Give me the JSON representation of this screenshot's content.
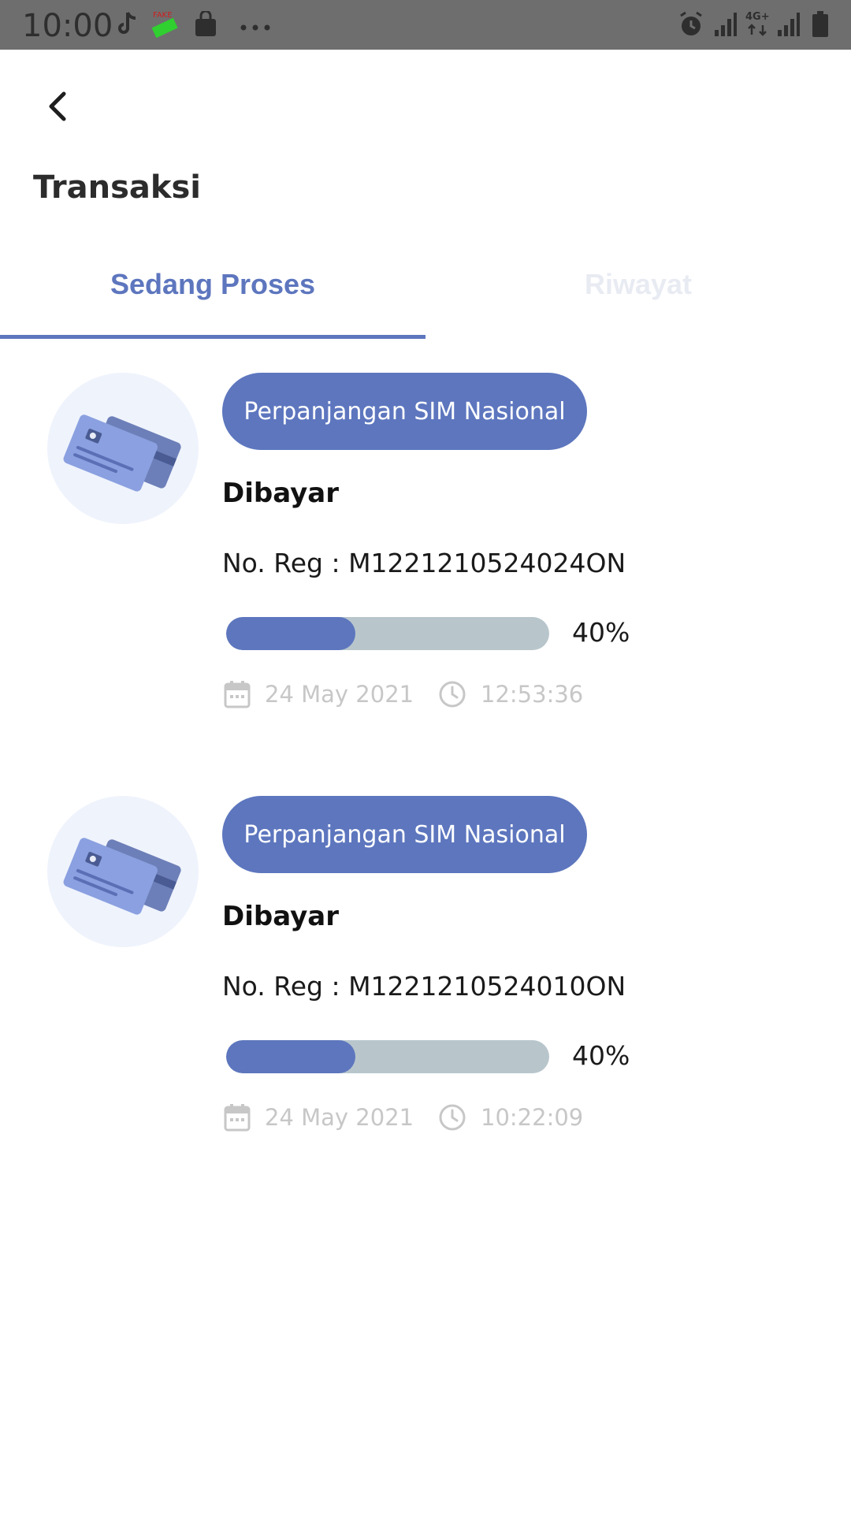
{
  "status_bar": {
    "time": "10:00",
    "left_icons": [
      "tiktok-icon",
      "fake-gps-icon",
      "shopping-bag-icon",
      "more-dots-icon"
    ],
    "right_icons": [
      "alarm-icon",
      "signal-icon",
      "network-4g-icon",
      "signal-icon",
      "battery-icon"
    ],
    "network_label": "4G+"
  },
  "header": {
    "title": "Transaksi"
  },
  "tabs": [
    {
      "label": "Sedang Proses",
      "active": true
    },
    {
      "label": "Riwayat",
      "active": false
    }
  ],
  "transactions": [
    {
      "service": "Perpanjangan SIM Nasional",
      "status": "Dibayar",
      "reg_no": "No. Reg : M1221210524024ON",
      "progress": 0.4,
      "progress_label": "40%",
      "date": "24 May 2021",
      "time": "12:53:36"
    },
    {
      "service": "Perpanjangan SIM Nasional",
      "status": "Dibayar",
      "reg_no": "No. Reg : M1221210524010ON",
      "progress": 0.4,
      "progress_label": "40%",
      "date": "24 May 2021",
      "time": "10:22:09"
    }
  ],
  "colors": {
    "accent": "#5d76be",
    "track": "#b8c6cc",
    "avatar_bg": "#eff3fc",
    "meta_text": "#c7c7c7",
    "status_bar_bg": "#6e6e6e"
  }
}
